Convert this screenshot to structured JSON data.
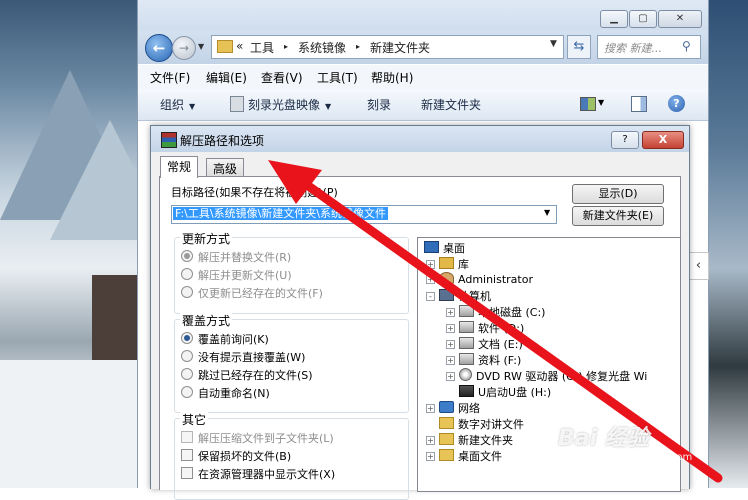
{
  "explorer": {
    "window_controls": {
      "minimize": "▁",
      "maximize": "▢",
      "close": "✕"
    },
    "address": {
      "prefix": "«",
      "crumbs": [
        "工具",
        "系统镜像",
        "新建文件夹"
      ],
      "separator": "▸"
    },
    "search": {
      "placeholder": "搜索 新建..."
    },
    "menu": [
      "文件(F)",
      "编辑(E)",
      "查看(V)",
      "工具(T)",
      "帮助(H)"
    ],
    "toolbar": {
      "organize": "组织",
      "burn_image": "刻录光盘映像",
      "burn": "刻录",
      "new_folder": "新建文件夹"
    }
  },
  "dialog": {
    "title": "解压路径和选项",
    "help_btn": "?",
    "close_btn": "X",
    "tabs": [
      "常规",
      "高级"
    ],
    "active_tab": "常规",
    "destination": {
      "label": "目标路径(如果不存在将被创建)(P)",
      "value": "F:\\工具\\系统镜像\\新建文件夹\\系统镜像文件"
    },
    "buttons": {
      "show": "显示(D)",
      "new_folder": "新建文件夹(E)"
    },
    "update_mode": {
      "title": "更新方式",
      "options": [
        {
          "label": "解压并替换文件(R)",
          "checked": true,
          "enabled": false
        },
        {
          "label": "解压并更新文件(U)",
          "checked": false,
          "enabled": false
        },
        {
          "label": "仅更新已经存在的文件(F)",
          "checked": false,
          "enabled": false
        }
      ]
    },
    "overwrite_mode": {
      "title": "覆盖方式",
      "options": [
        {
          "label": "覆盖前询问(K)",
          "checked": true
        },
        {
          "label": "没有提示直接覆盖(W)",
          "checked": false
        },
        {
          "label": "跳过已经存在的文件(S)",
          "checked": false
        },
        {
          "label": "自动重命名(N)",
          "checked": false
        }
      ]
    },
    "other": {
      "title": "其它",
      "options": [
        {
          "label": "解压压缩文件到子文件夹(L)",
          "checked": false,
          "enabled": false
        },
        {
          "label": "保留损坏的文件(B)",
          "checked": false,
          "enabled": true
        },
        {
          "label": "在资源管理器中显示文件(X)",
          "checked": false,
          "enabled": true
        }
      ]
    },
    "tree": [
      {
        "label": "桌面",
        "icon": "desktop-icon",
        "level": 0,
        "expander": ""
      },
      {
        "label": "库",
        "icon": "library-icon",
        "level": 1,
        "expander": "+"
      },
      {
        "label": "Administrator",
        "icon": "user-icon",
        "level": 1,
        "expander": "+"
      },
      {
        "label": "计算机",
        "icon": "computer-icon",
        "level": 1,
        "expander": "-"
      },
      {
        "label": "本地磁盘 (C:)",
        "icon": "disk-icon",
        "level": 2,
        "expander": "+"
      },
      {
        "label": "软件 (D:)",
        "icon": "disk-icon",
        "level": 2,
        "expander": "+"
      },
      {
        "label": "文档 (E:)",
        "icon": "disk-icon",
        "level": 2,
        "expander": "+"
      },
      {
        "label": "资料 (F:)",
        "icon": "disk-icon",
        "level": 2,
        "expander": "+"
      },
      {
        "label": "DVD RW 驱动器 (G:) 修复光盘 Wi",
        "icon": "dvd-icon",
        "level": 2,
        "expander": "+"
      },
      {
        "label": "U启动U盘 (H:)",
        "icon": "usb-drive-icon",
        "level": 2,
        "expander": ""
      },
      {
        "label": "网络",
        "icon": "network-icon",
        "level": 1,
        "expander": "+"
      },
      {
        "label": "数字对讲文件",
        "icon": "folder-icon",
        "level": 1,
        "expander": ""
      },
      {
        "label": "新建文件夹",
        "icon": "folder-icon",
        "level": 1,
        "expander": "+"
      },
      {
        "label": "桌面文件",
        "icon": "folder-icon",
        "level": 1,
        "expander": "+"
      }
    ]
  },
  "watermark": {
    "brand": "Bai 经验",
    "url": "jingyan.baidu.com"
  },
  "colors": {
    "arrow": "#e8131b",
    "selection": "#3399ff",
    "dialog_close": "#c44233"
  }
}
